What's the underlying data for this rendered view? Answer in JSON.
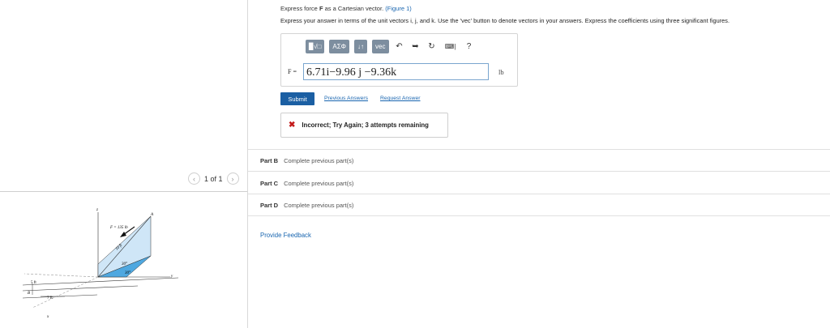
{
  "question": {
    "line1_prefix": "Express force ",
    "line1_bold": "F",
    "line1_mid": " as a Cartesian vector. ",
    "figure_link": "(Figure 1)",
    "instructions": "Express your answer in terms of the unit vectors i, j, and k. Use the 'vec' button to denote vectors in your answers. Express the coefficients using three significant figures."
  },
  "toolbar": {
    "templates_label": "▉√□",
    "greek_label": "AΣΦ",
    "arrows_label": "↓↑",
    "vec_label": "vec",
    "keyboard_label": "⌨|",
    "help_label": "?"
  },
  "answer": {
    "label": "F =",
    "value": "6.71i−9.96 j −9.36k",
    "unit": "lb"
  },
  "actions": {
    "submit": "Submit",
    "previous": "Previous Answers",
    "request": "Request Answer"
  },
  "feedback": {
    "message": "Incorrect; Try Again; 3 attempts remaining"
  },
  "parts": [
    {
      "label": "Part B",
      "text": "Complete previous part(s)"
    },
    {
      "label": "Part C",
      "text": "Complete previous part(s)"
    },
    {
      "label": "Part D",
      "text": "Complete previous part(s)"
    }
  ],
  "provide_feedback": "Provide Feedback",
  "figure": {
    "pager": "1 of 1",
    "force_label": "F = 135 lb",
    "length_label": "10 ft",
    "angle1": "30°",
    "angle2": "30°",
    "dim1": "5 ft",
    "dim2": "7 ft",
    "axis_x": "x",
    "axis_y": "y",
    "axis_z": "z",
    "point_a": "A",
    "point_b": "B"
  },
  "colors": {
    "accent": "#1b5fa3",
    "link": "#1a66b0",
    "error": "#c31b1b",
    "toolbar": "#7d8e9f",
    "plane_fill": "#cfe6f7",
    "triangle_fill": "#4fa8e0"
  }
}
